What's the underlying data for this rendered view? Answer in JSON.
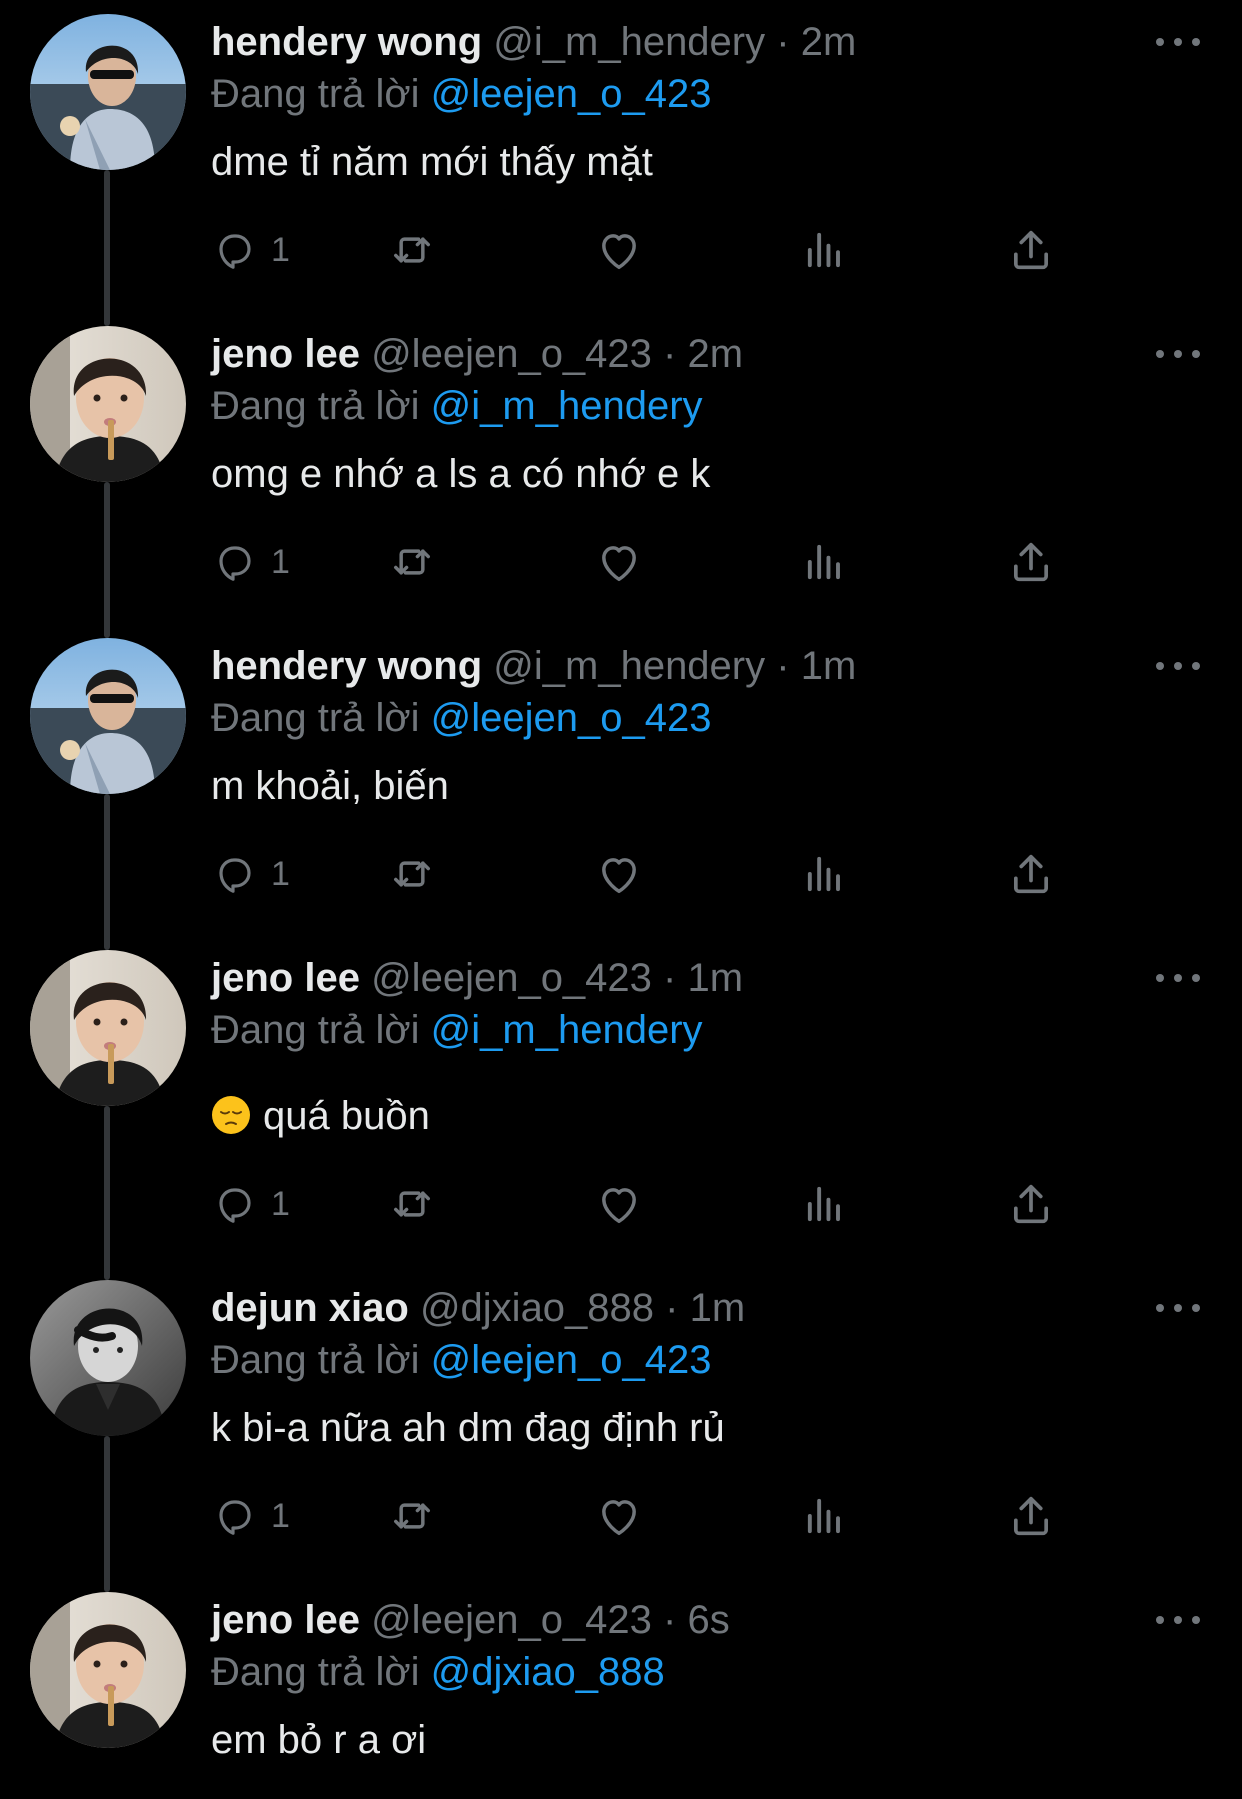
{
  "theme": {
    "background": "#000000",
    "text_primary": "#e7e9ea",
    "text_secondary": "#71767b",
    "accent": "#1d9bf0",
    "thread_line": "#333639"
  },
  "icons": {
    "more": "more-horizontal-icon",
    "reply": "comment-bubble-icon",
    "retweet": "retweet-arrows-icon",
    "like": "heart-icon",
    "views": "bar-chart-icon",
    "share": "share-upload-icon",
    "emoji_pensive": "pensive-face-emoji"
  },
  "replying_prefix": "Đang trả lời",
  "tweets": [
    {
      "name": "hendery wong",
      "handle": "@i_m_hendery",
      "separator": "·",
      "time": "2m",
      "reply_to": "@leejen_o_423",
      "text": "dme tỉ năm mới thấy mặt",
      "reply_count": "1"
    },
    {
      "name": "jeno lee",
      "handle": "@leejen_o_423",
      "separator": "·",
      "time": "2m",
      "reply_to": "@i_m_hendery",
      "text": "omg e nhớ a ls a có nhớ e k",
      "reply_count": "1"
    },
    {
      "name": "hendery wong",
      "handle": "@i_m_hendery",
      "separator": "·",
      "time": "1m",
      "reply_to": "@leejen_o_423",
      "text": "m khoải, biến",
      "reply_count": "1"
    },
    {
      "name": "jeno lee",
      "handle": "@leejen_o_423",
      "separator": "·",
      "time": "1m",
      "reply_to": "@i_m_hendery",
      "text": "quá buồn",
      "reply_count": "1"
    },
    {
      "name": "dejun xiao",
      "handle": "@djxiao_888",
      "separator": "·",
      "time": "1m",
      "reply_to": "@leejen_o_423",
      "text": "k bi-a nữa ah dm đag định rủ",
      "reply_count": "1"
    },
    {
      "name": "jeno lee",
      "handle": "@leejen_o_423",
      "separator": "·",
      "time": "6s",
      "reply_to": "@djxiao_888",
      "text": "em bỏ r a ơi"
    }
  ]
}
